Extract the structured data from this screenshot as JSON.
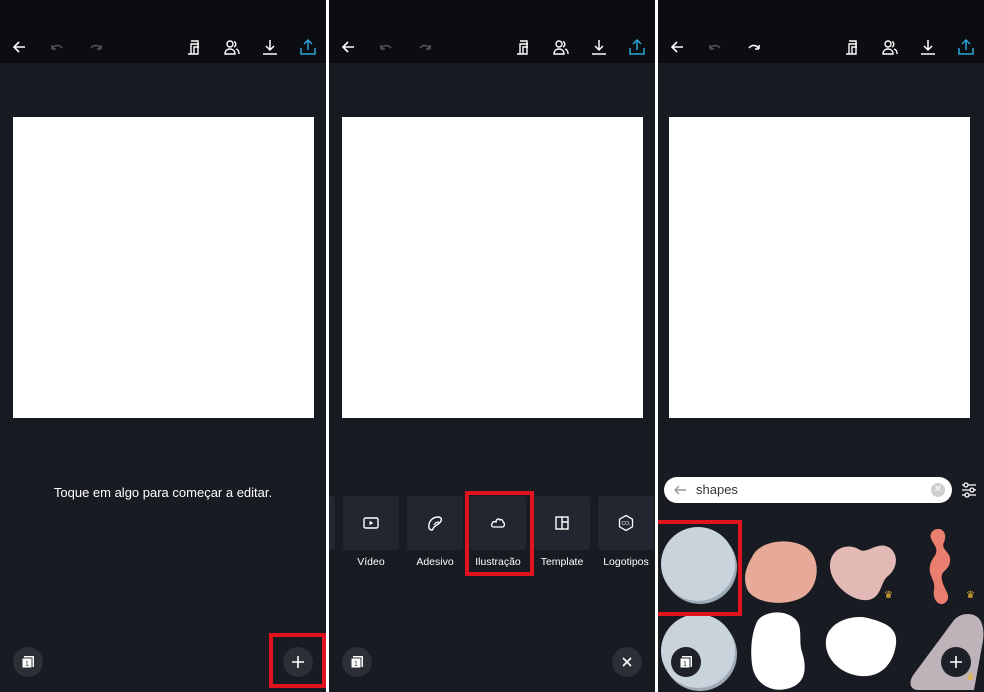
{
  "panels": [
    {
      "hint": "Toque em algo para começar a editar.",
      "page_count": "1"
    },
    {
      "page_count": "1",
      "add_options": [
        {
          "label": "Vídeo",
          "icon": "video-icon"
        },
        {
          "label": "Adesivo",
          "icon": "sticker-icon"
        },
        {
          "label": "Ilustração",
          "icon": "illustration-icon"
        },
        {
          "label": "Template",
          "icon": "template-icon"
        },
        {
          "label": "Logotipos",
          "icon": "logo-icon"
        }
      ]
    },
    {
      "page_count": "1",
      "search": {
        "value": "shapes"
      }
    }
  ],
  "toolbar_icons": [
    "back-icon",
    "undo-icon",
    "redo-icon",
    "resize-icon",
    "share-people-icon",
    "download-icon",
    "export-icon"
  ],
  "colors": {
    "background": "#181b21",
    "topbar": "#0c0d11",
    "accent_export": "#2aa6d8",
    "highlight": "#e0141e",
    "premium_crown": "#e8b53a"
  }
}
